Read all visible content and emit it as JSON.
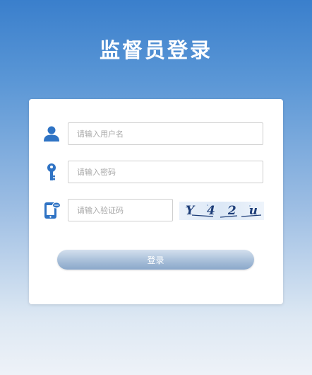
{
  "page_title": "监督员登录",
  "form": {
    "username_placeholder": "请输入用户名",
    "password_placeholder": "请输入密码",
    "captcha_placeholder": "请输入验证码",
    "captcha_chars": [
      "Y",
      "4",
      "2",
      "u"
    ],
    "login_label": "登录"
  },
  "icons": {
    "username": "user-icon",
    "password": "key-icon",
    "captcha": "phone-verify-icon"
  },
  "colors": {
    "accent": "#2f73c4",
    "background_top": "#3a7fcc",
    "background_bottom": "#eef2f8"
  }
}
